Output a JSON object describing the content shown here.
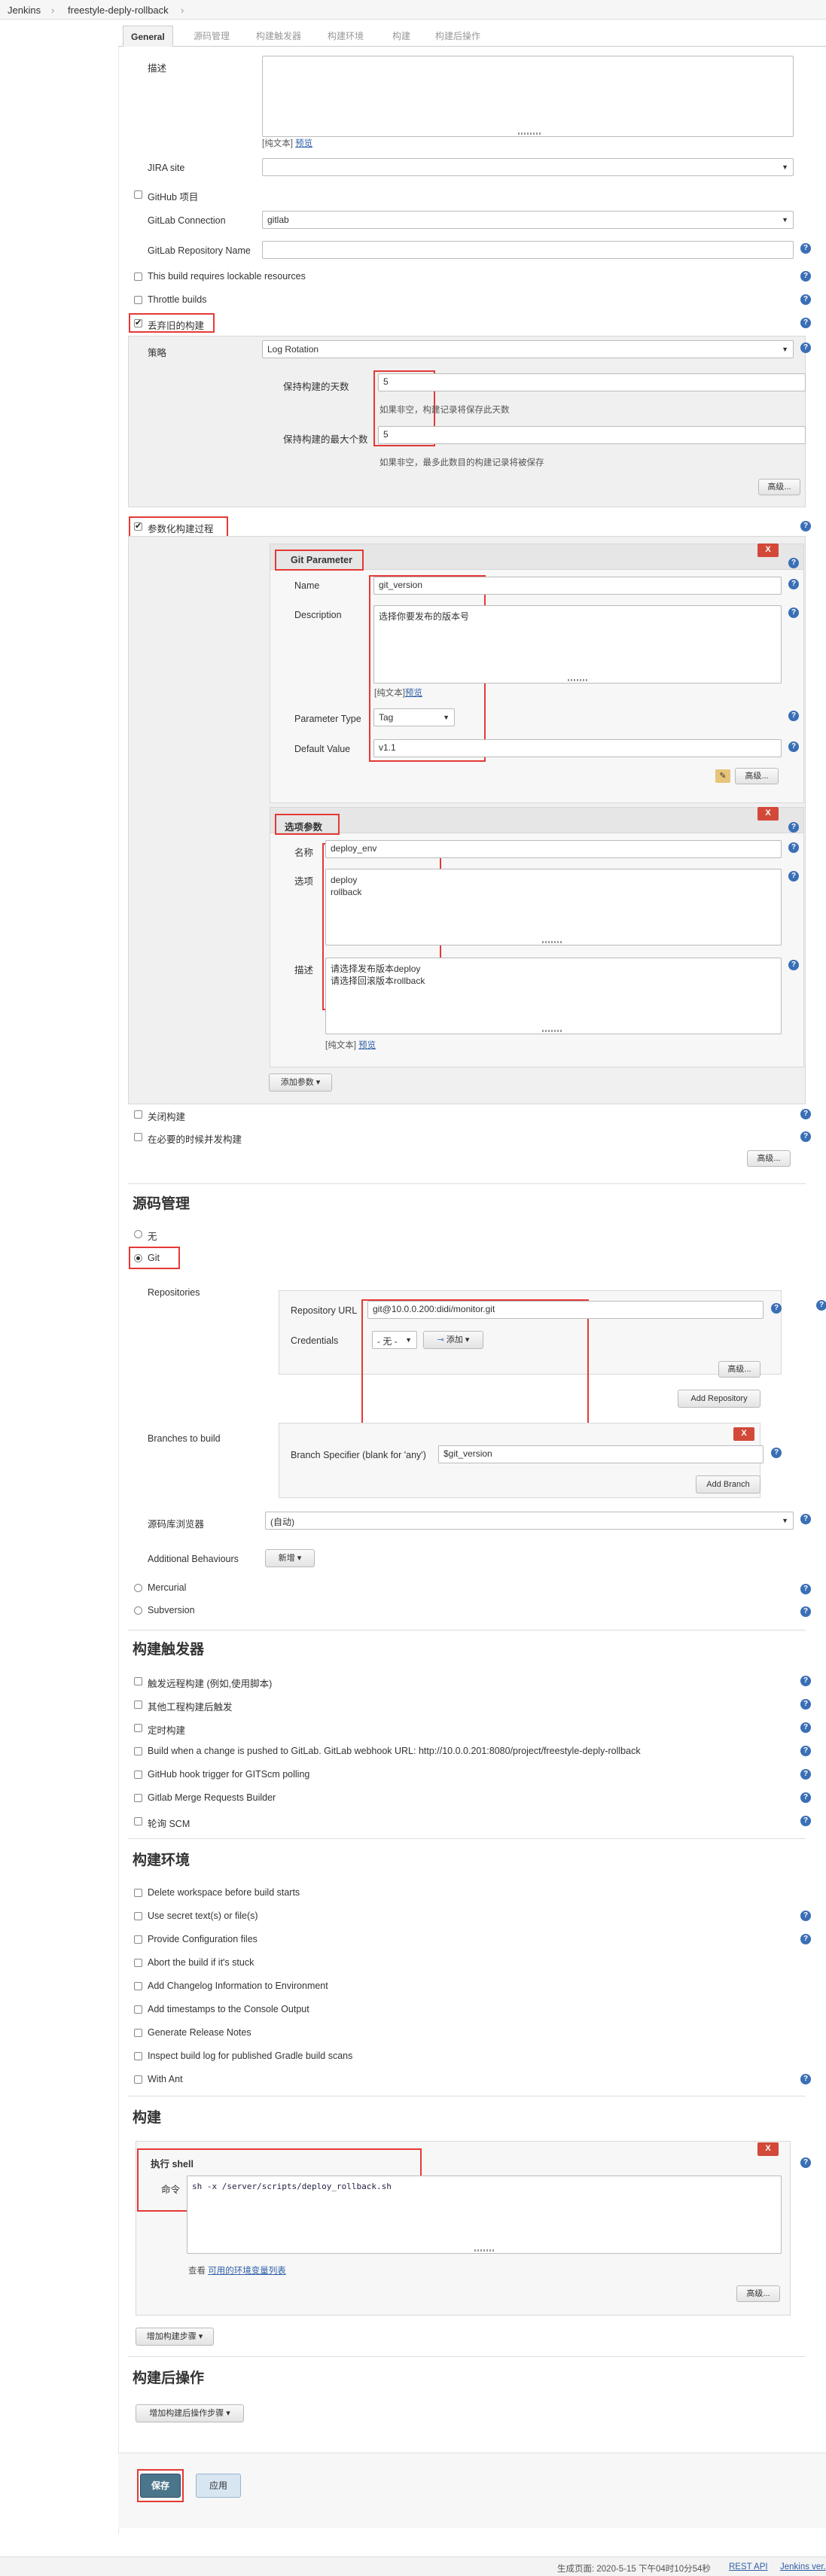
{
  "breadcrumb": {
    "root": "Jenkins",
    "job": "freestyle-deply-rollback"
  },
  "tabs": [
    "General",
    "源码管理",
    "构建触发器",
    "构建环境",
    "构建",
    "构建后操作"
  ],
  "general": {
    "description_label": "描述",
    "plain_text": "[纯文本]",
    "preview": "预览",
    "jira_label": "JIRA site",
    "jira_value": "",
    "github_project": "GitHub 项目",
    "gitlab_connection_label": "GitLab Connection",
    "gitlab_connection_value": "gitlab",
    "gitlab_repo_label": "GitLab Repository Name",
    "lockable": "This build requires lockable resources",
    "throttle": "Throttle builds",
    "discard_old": "丢弃旧的构建",
    "strategy_label": "策略",
    "strategy_value": "Log Rotation",
    "days_label": "保持构建的天数",
    "days_value": "5",
    "days_hint": "如果非空，构建记录将保存此天数",
    "max_label": "保持构建的最大个数",
    "max_value": "5",
    "max_hint": "如果非空，最多此数目的构建记录将被保存",
    "advanced": "高级...",
    "parameterized": "参数化构建过程",
    "git_param": {
      "title": "Git Parameter",
      "name_label": "Name",
      "name_value": "git_version",
      "desc_label": "Description",
      "desc_value": "选择你要发布的版本号",
      "plain_text": "[纯文本]",
      "preview": "预览",
      "type_label": "Parameter Type",
      "type_value": "Tag",
      "default_label": "Default Value",
      "default_value": "v1.1",
      "advanced": "高级..."
    },
    "choice_param": {
      "title": "选项参数",
      "name_label": "名称",
      "name_value": "deploy_env",
      "options_label": "选项",
      "options_value": "deploy\nrollback",
      "desc_label": "描述",
      "desc_value": "请选择发布版本deploy\n请选择回滚版本rollback",
      "plain_text": "[纯文本]",
      "preview": "预览"
    },
    "add_param": "添加参数",
    "close_build": "关闭构建",
    "concurrent": "在必要的时候并发构建",
    "advanced2": "高级..."
  },
  "scm": {
    "title": "源码管理",
    "none": "无",
    "git": "Git",
    "repositories_label": "Repositories",
    "repo_url_label": "Repository URL",
    "repo_url_value": "git@10.0.0.200:didi/monitor.git",
    "credentials_label": "Credentials",
    "credentials_value": "- 无 -",
    "add_label": "添加",
    "advanced": "高级...",
    "add_repository": "Add Repository",
    "branches_label": "Branches to build",
    "branch_spec_label": "Branch Specifier (blank for 'any')",
    "branch_spec_value": "$git_version",
    "add_branch": "Add Branch",
    "browser_label": "源码库浏览器",
    "browser_value": "(自动)",
    "additional_label": "Additional Behaviours",
    "add_new": "新增",
    "mercurial": "Mercurial",
    "subversion": "Subversion"
  },
  "triggers": {
    "title": "构建触发器",
    "items": [
      "触发远程构建 (例如,使用脚本)",
      "其他工程构建后触发",
      "定时构建",
      "Build when a change is pushed to GitLab. GitLab webhook URL: http://10.0.0.201:8080/project/freestyle-deply-rollback",
      "GitHub hook trigger for GITScm polling",
      "Gitlab Merge Requests Builder",
      "轮询 SCM"
    ]
  },
  "env": {
    "title": "构建环境",
    "items": [
      "Delete workspace before build starts",
      "Use secret text(s) or file(s)",
      "Provide Configuration files",
      "Abort the build if it's stuck",
      "Add Changelog Information to Environment",
      "Add timestamps to the Console Output",
      "Generate Release Notes",
      "Inspect build log for published Gradle build scans",
      "With Ant"
    ]
  },
  "build": {
    "title": "构建",
    "step_title": "执行 shell",
    "command_label": "命令",
    "command_value": "sh -x /server/scripts/deploy_rollback.sh",
    "see_prefix": "查看",
    "env_link": "可用的环境变量列表",
    "advanced": "高级...",
    "add_step": "增加构建步骤"
  },
  "post": {
    "title": "构建后操作",
    "add_step": "增加构建后操作步骤"
  },
  "actions": {
    "save": "保存",
    "apply": "应用"
  },
  "footer": {
    "generated": "生成页面: 2020-5-15 下午04时10分54秒",
    "rest": "REST API",
    "version": "Jenkins ver."
  },
  "colors": {
    "accent": "#3a6fb5",
    "highlight": "#e53935",
    "delete": "#d24939"
  }
}
